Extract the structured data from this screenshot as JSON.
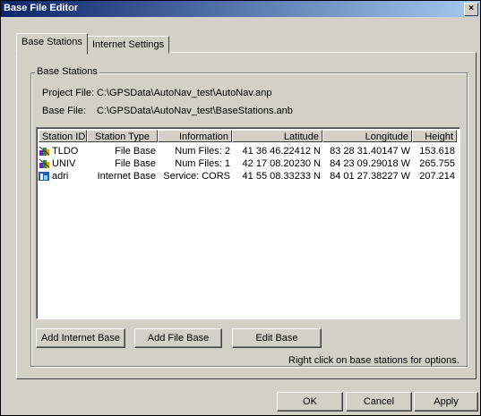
{
  "window": {
    "title": "Base File Editor",
    "close_glyph": "×"
  },
  "tabs": [
    {
      "label": "Base Stations",
      "active": true
    },
    {
      "label": "Internet Settings",
      "active": false
    }
  ],
  "group": {
    "legend": "Base Stations",
    "project_file_label": "Project File:",
    "project_file_value": "C:\\GPSData\\AutoNav_test\\AutoNav.anp",
    "base_file_label": "Base File:",
    "base_file_value": "C:\\GPSData\\AutoNav_test\\BaseStations.anb"
  },
  "table": {
    "columns": [
      "Station ID",
      "Station Type",
      "Information",
      "Latitude",
      "Longitude",
      "Height"
    ],
    "rows": [
      {
        "icon": "file-base-station-icon",
        "id": "TLDO",
        "type": "File Base",
        "info": "Num Files: 2",
        "lat": "41 36 46.22412 N",
        "lon": "83 28 31.40147 W",
        "height": "153.618"
      },
      {
        "icon": "file-base-station-icon",
        "id": "UNIV",
        "type": "File Base",
        "info": "Num Files: 1",
        "lat": "42 17 08.20230 N",
        "lon": "84 23 09.29018 W",
        "height": "265.755"
      },
      {
        "icon": "internet-base-station-icon",
        "id": "adri",
        "type": "Internet Base",
        "info": "Service: CORS",
        "lat": "41 55 08.33233 N",
        "lon": "84 01 27.38227 W",
        "height": "207.214"
      }
    ]
  },
  "buttons": {
    "add_internet": "Add Internet Base",
    "add_file": "Add File Base",
    "edit": "Edit Base",
    "ok": "OK",
    "cancel": "Cancel",
    "apply": "Apply"
  },
  "hint": "Right click on base stations for options."
}
